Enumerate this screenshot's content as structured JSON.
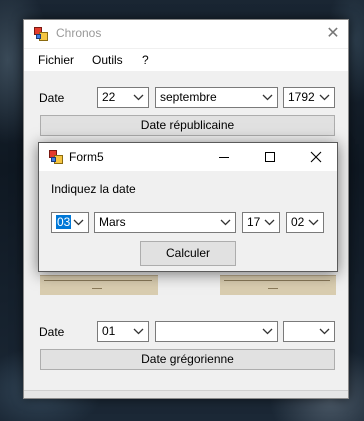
{
  "main": {
    "title": "Chronos",
    "menu": [
      "Fichier",
      "Outils",
      "?"
    ],
    "top_row": {
      "label": "Date",
      "day": "22",
      "month": "septembre",
      "year": "1792",
      "button": "Date républicaine"
    },
    "bottom_row": {
      "label": "Date",
      "day": "01",
      "month": "",
      "year": "",
      "button": "Date grégorienne"
    }
  },
  "dialog": {
    "title": "Form5",
    "prompt": "Indiquez la date",
    "day": "03",
    "month": "Mars",
    "hour": "17",
    "minute": "02",
    "button": "Calculer"
  },
  "icons": {
    "app": "app-icon",
    "close": "close-icon",
    "minimize": "minimize-icon",
    "maximize": "maximize-icon",
    "dropdown": "chevron-down-icon"
  }
}
